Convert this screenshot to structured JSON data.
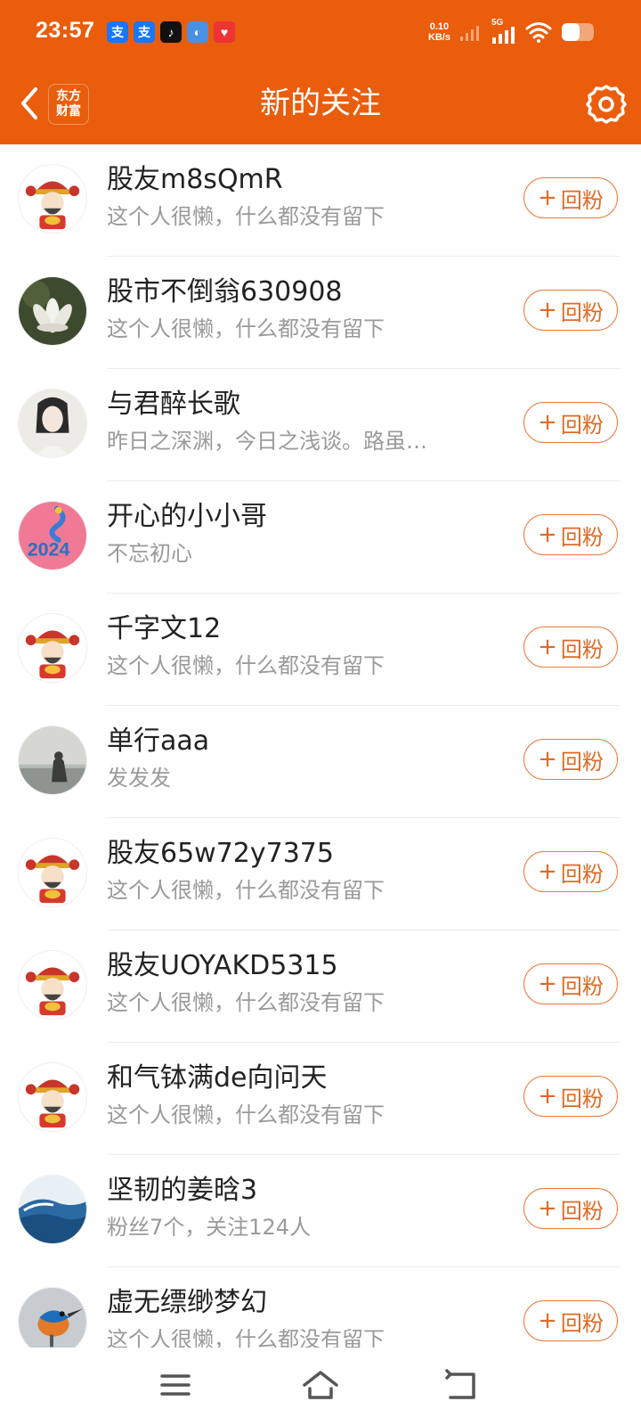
{
  "status_bar": {
    "time": "23:57",
    "net_speed_value": "0.10",
    "net_speed_unit": "KB/s",
    "network_type": "5G",
    "app_icons": [
      "alipay-icon",
      "alipay-icon",
      "tiktok-icon",
      "app-icon",
      "heart-app-icon"
    ]
  },
  "header": {
    "title": "新的关注",
    "brand_line1": "东方",
    "brand_line2": "财富",
    "back_icon": "chevron-left-icon",
    "settings_icon": "gear-icon"
  },
  "colors": {
    "header_bg": "#e95d0c",
    "accent": "#e06a25",
    "name_text": "#222222",
    "bio_text": "#9a9a9a"
  },
  "follow_button_label": "回粉",
  "follow_button_prefix": "+",
  "followers": [
    {
      "name": "股友m8sQmR",
      "bio": "这个人很懒，什么都没有留下",
      "avatar": "caishen-avatar"
    },
    {
      "name": "股市不倒翁630908",
      "bio": "这个人很懒，什么都没有留下",
      "avatar": "lotus-avatar"
    },
    {
      "name": "与君醉长歌",
      "bio": "昨日之深渊，今日之浅谈。路虽…",
      "avatar": "portrait-avatar"
    },
    {
      "name": "开心的小小哥",
      "bio": "不忘初心",
      "avatar": "dragon-2024-avatar"
    },
    {
      "name": "千字文12",
      "bio": "这个人很懒，什么都没有留下",
      "avatar": "caishen-avatar"
    },
    {
      "name": "单行aaa",
      "bio": "发发发",
      "avatar": "seaside-avatar"
    },
    {
      "name": "股友65w72y7375",
      "bio": "这个人很懒，什么都没有留下",
      "avatar": "caishen-avatar"
    },
    {
      "name": "股友UOYAKD5315",
      "bio": "这个人很懒，什么都没有留下",
      "avatar": "caishen-avatar"
    },
    {
      "name": "和气钵满de向问天",
      "bio": "这个人很懒，什么都没有留下",
      "avatar": "caishen-avatar"
    },
    {
      "name": "坚韧的姜晗3",
      "bio": "粉丝7个，关注124人",
      "avatar": "wave-avatar"
    },
    {
      "name": "虚无缥缈梦幻",
      "bio": "这个人很懒，什么都没有留下",
      "avatar": "kingfisher-avatar"
    }
  ],
  "bottom_nav": {
    "menu_icon": "menu-icon",
    "home_icon": "home-icon",
    "back_icon": "back-icon"
  }
}
